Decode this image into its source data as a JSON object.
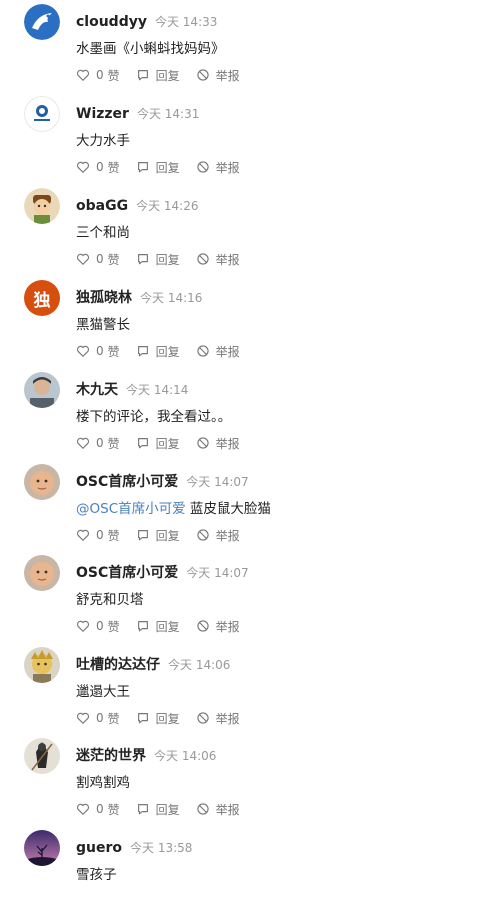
{
  "action_labels": {
    "like": "赞",
    "reply": "回复",
    "report": "举报"
  },
  "comments": [
    {
      "user": "clouddyy",
      "time": "今天 14:33",
      "text": "水墨画《小蝌蚪找妈妈》",
      "likes": "0",
      "avatar": "bird-logo"
    },
    {
      "user": "Wizzer",
      "time": "今天 14:31",
      "text": "大力水手",
      "likes": "0",
      "avatar": "blue-emblem"
    },
    {
      "user": "obaGG",
      "time": "今天 14:26",
      "text": "三个和尚",
      "likes": "0",
      "avatar": "cartoon-character"
    },
    {
      "user": "独孤晓林",
      "time": "今天 14:16",
      "text": "黑猫警长",
      "likes": "0",
      "avatar_letter": "独",
      "avatar": "letter"
    },
    {
      "user": "木九天",
      "time": "今天 14:14",
      "text": "楼下的评论，我全看过。。",
      "likes": "0",
      "avatar": "portrait"
    },
    {
      "user": "OSC首席小可爱",
      "time": "今天 14:07",
      "mention": "@OSC首席小可爱",
      "text": " 蓝皮鼠大脸猫",
      "likes": "0",
      "avatar": "baby-photo"
    },
    {
      "user": "OSC首席小可爱",
      "time": "今天 14:07",
      "text": "舒克和贝塔",
      "likes": "0",
      "avatar": "baby-photo"
    },
    {
      "user": "吐槽的达达仔",
      "time": "今天 14:06",
      "text": "邋遢大王",
      "likes": "0",
      "avatar": "cartoon-yellow"
    },
    {
      "user": "迷茫的世界",
      "time": "今天 14:06",
      "text": "割鸡割鸡",
      "likes": "0",
      "avatar": "dark-figure"
    },
    {
      "user": "guero",
      "time": "今天 13:58",
      "text": "雪孩子",
      "avatar": "purple-sky"
    }
  ]
}
